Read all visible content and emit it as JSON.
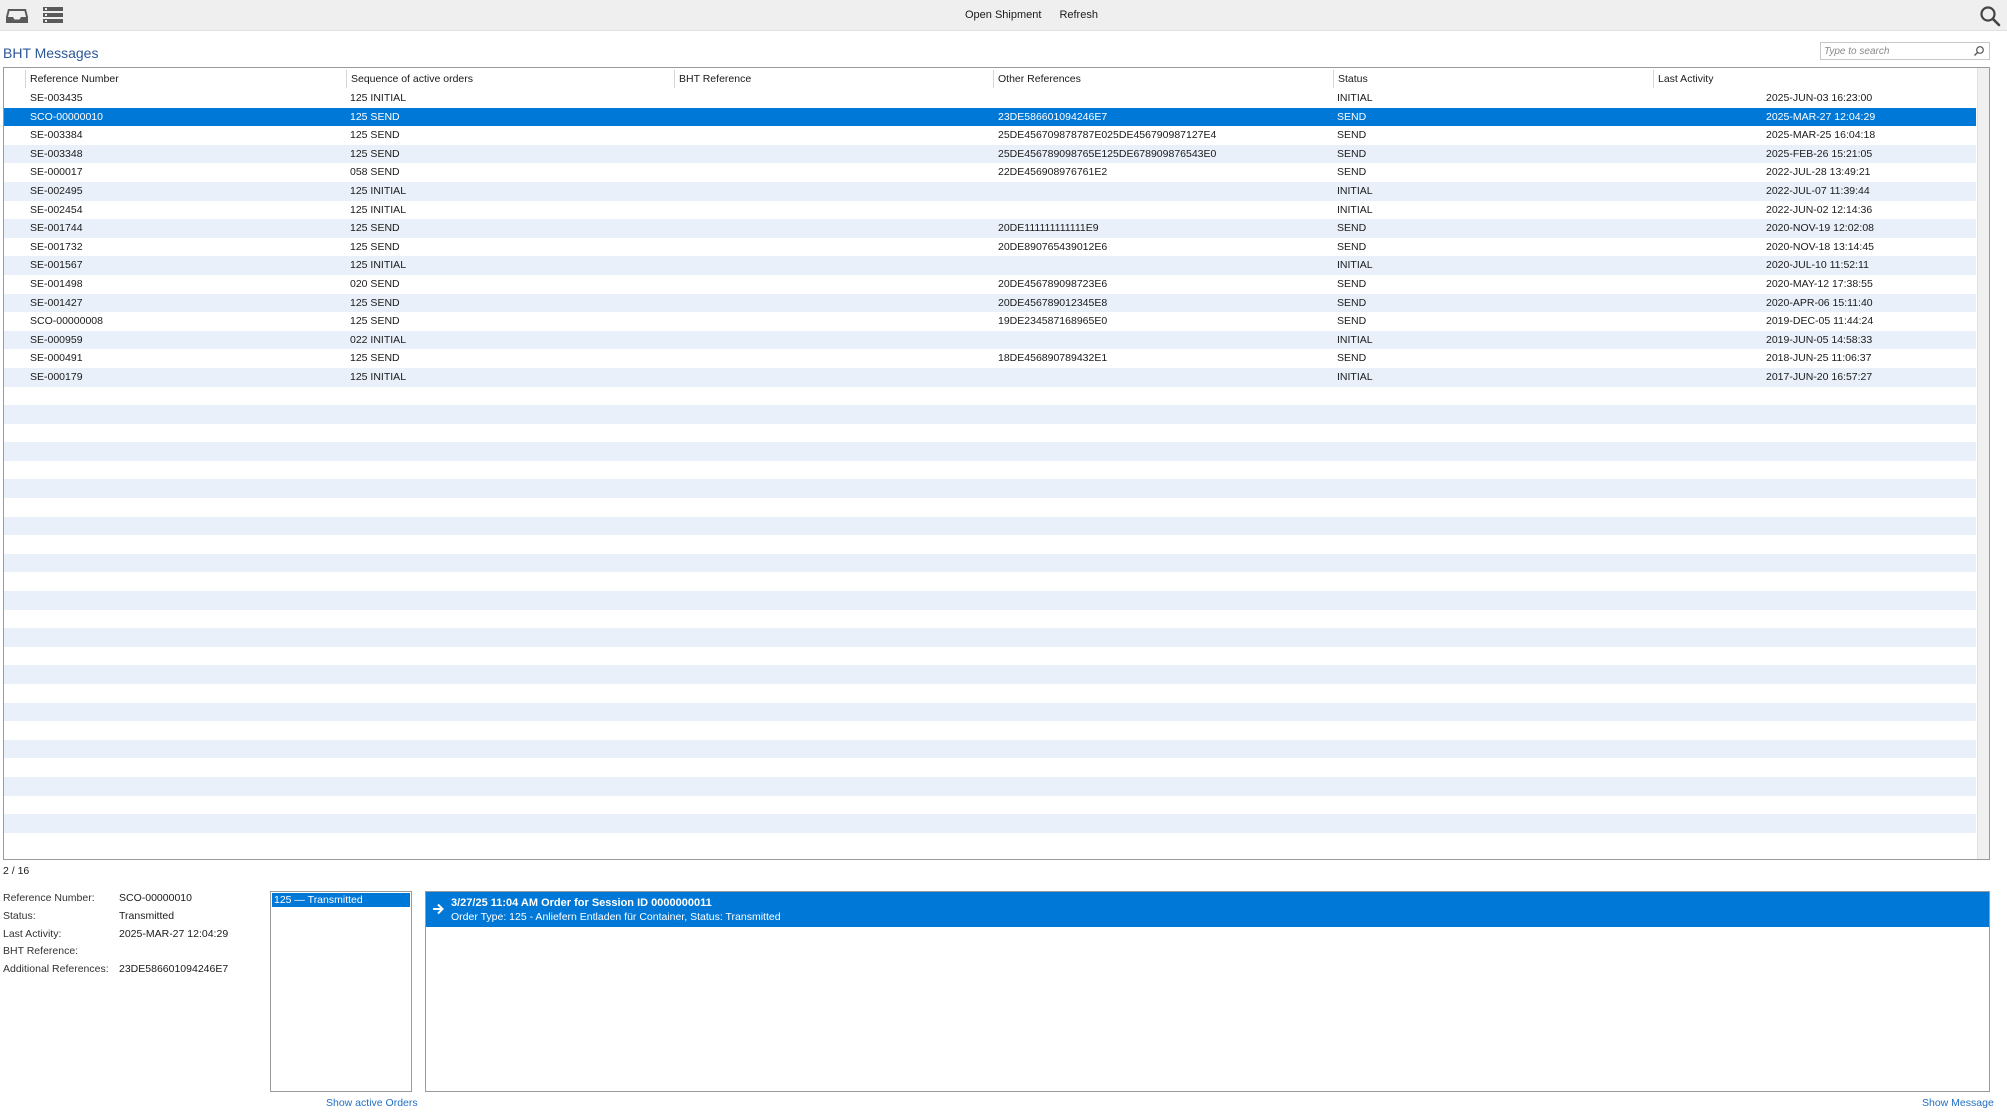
{
  "toolbar": {
    "left_icons": [
      "inbox-icon",
      "list-menu-icon"
    ],
    "open_shipment_label": "Open Shipment",
    "refresh_label": "Refresh",
    "search_icon": "search-icon"
  },
  "section": {
    "title": "BHT Messages",
    "search_placeholder": "Type to search"
  },
  "table": {
    "columns": [
      "Reference Number",
      "Sequence of active orders",
      "BHT Reference",
      "Other References",
      "Status",
      "Last Activity"
    ],
    "selected_index": 1,
    "empty_row_count": 25,
    "rows": [
      {
        "ref": "SE-003435",
        "seq": "125 INITIAL",
        "bht": "",
        "other": "",
        "status": "INITIAL",
        "last": "2025-JUN-03 16:23:00"
      },
      {
        "ref": "SCO-00000010",
        "seq": "125 SEND",
        "bht": "",
        "other": "23DE586601094246E7",
        "status": "SEND",
        "last": "2025-MAR-27 12:04:29"
      },
      {
        "ref": "SE-003384",
        "seq": "125 SEND",
        "bht": "",
        "other": "25DE456709878787E025DE456790987127E4",
        "status": "SEND",
        "last": "2025-MAR-25 16:04:18"
      },
      {
        "ref": "SE-003348",
        "seq": "125 SEND",
        "bht": "",
        "other": "25DE456789098765E125DE678909876543E0",
        "status": "SEND",
        "last": "2025-FEB-26 15:21:05"
      },
      {
        "ref": "SE-000017",
        "seq": "058 SEND",
        "bht": "",
        "other": "22DE456908976761E2",
        "status": "SEND",
        "last": "2022-JUL-28 13:49:21"
      },
      {
        "ref": "SE-002495",
        "seq": "125 INITIAL",
        "bht": "",
        "other": "",
        "status": "INITIAL",
        "last": "2022-JUL-07 11:39:44"
      },
      {
        "ref": "SE-002454",
        "seq": "125 INITIAL",
        "bht": "",
        "other": "",
        "status": "INITIAL",
        "last": "2022-JUN-02 12:14:36"
      },
      {
        "ref": "SE-001744",
        "seq": "125 SEND",
        "bht": "",
        "other": "20DE111111111111E9",
        "status": "SEND",
        "last": "2020-NOV-19 12:02:08"
      },
      {
        "ref": "SE-001732",
        "seq": "125 SEND",
        "bht": "",
        "other": "20DE890765439012E6",
        "status": "SEND",
        "last": "2020-NOV-18 13:14:45"
      },
      {
        "ref": "SE-001567",
        "seq": "125 INITIAL",
        "bht": "",
        "other": "",
        "status": "INITIAL",
        "last": "2020-JUL-10 11:52:11"
      },
      {
        "ref": "SE-001498",
        "seq": "020 SEND",
        "bht": "",
        "other": "20DE456789098723E6",
        "status": "SEND",
        "last": "2020-MAY-12 17:38:55"
      },
      {
        "ref": "SE-001427",
        "seq": "125 SEND",
        "bht": "",
        "other": "20DE456789012345E8",
        "status": "SEND",
        "last": "2020-APR-06 15:11:40"
      },
      {
        "ref": "SCO-00000008",
        "seq": "125 SEND",
        "bht": "",
        "other": "19DE234587168965E0",
        "status": "SEND",
        "last": "2019-DEC-05 11:44:24"
      },
      {
        "ref": "SE-000959",
        "seq": "022 INITIAL",
        "bht": "",
        "other": "",
        "status": "INITIAL",
        "last": "2019-JUN-05 14:58:33"
      },
      {
        "ref": "SE-000491",
        "seq": "125 SEND",
        "bht": "",
        "other": "18DE456890789432E1",
        "status": "SEND",
        "last": "2018-JUN-25 11:06:37"
      },
      {
        "ref": "SE-000179",
        "seq": "125 INITIAL",
        "bht": "",
        "other": "",
        "status": "INITIAL",
        "last": "2017-JUN-20 16:57:27"
      }
    ]
  },
  "count_text": "2 / 16",
  "details": [
    {
      "label": "Reference Number:",
      "value": "SCO-00000010"
    },
    {
      "label": "Status:",
      "value": "Transmitted"
    },
    {
      "label": "Last Activity:",
      "value": "2025-MAR-27 12:04:29"
    },
    {
      "label": "BHT Reference:",
      "value": ""
    },
    {
      "label": "Additional References:",
      "value": "23DE586601094246E7"
    }
  ],
  "orders": {
    "items": [
      "125 — Transmitted"
    ],
    "link_label": "Show active Orders"
  },
  "messages": {
    "items": [
      {
        "title": "3/27/25 11:04 AM    Order for Session ID 0000000011",
        "subtitle": "Order Type: 125 - Anliefern Entladen für Container, Status: Transmitted",
        "icon": "arrow-right-icon"
      }
    ],
    "link_label": "Show Message"
  },
  "colors": {
    "accent": "#0078d7",
    "title": "#2b5797",
    "link": "#1f6fc4",
    "row_alt": "#e9f0fa"
  }
}
